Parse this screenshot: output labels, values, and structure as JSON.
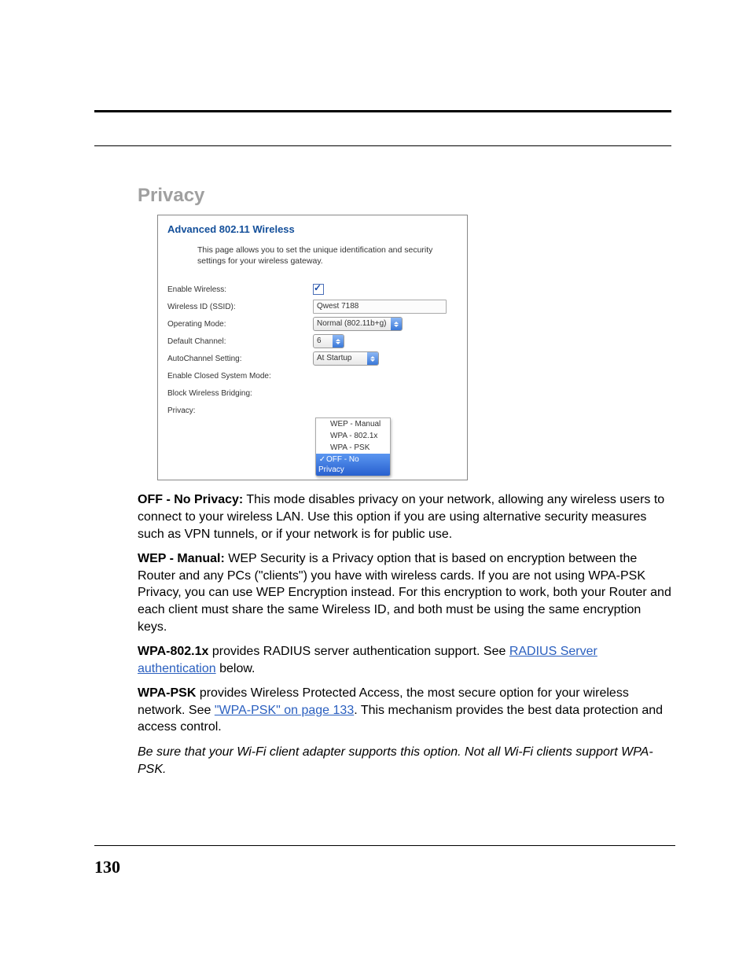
{
  "page_number": "130",
  "section_title": "Privacy",
  "screenshot": {
    "title": "Advanced 802.11 Wireless",
    "description": "This page allows you to set the unique identification and security settings for your wireless gateway.",
    "fields": {
      "enable_wireless": {
        "label": "Enable Wireless:",
        "checked": true
      },
      "ssid": {
        "label": "Wireless ID (SSID):",
        "value": "Qwest 7188"
      },
      "op_mode": {
        "label": "Operating Mode:",
        "value": "Normal (802.11b+g)"
      },
      "channel": {
        "label": "Default Channel:",
        "value": "6"
      },
      "autochannel": {
        "label": "AutoChannel Setting:",
        "value": "At Startup"
      },
      "closed_system": {
        "label": "Enable Closed System Mode:"
      },
      "block_bridging": {
        "label": "Block Wireless Bridging:"
      },
      "privacy": {
        "label": "Privacy:"
      }
    },
    "privacy_options": [
      "WEP - Manual",
      "WPA - 802.1x",
      "WPA - PSK",
      "OFF - No Privacy"
    ],
    "privacy_selected": "OFF - No Privacy"
  },
  "paragraphs": {
    "off": {
      "heading": "OFF - No Privacy:",
      "text": " This mode disables privacy on your network, allowing any wireless users to connect to your wireless LAN. Use this option if you are using alternative security measures such as VPN tunnels, or if your network is for public use."
    },
    "wep": {
      "heading": "WEP - Manual:",
      "text": " WEP Security is a Privacy option that is based on encryption between the Router and any PCs (\"clients\") you have with wireless cards. If you are not using WPA-PSK Privacy, you can use WEP Encryption instead. For this encryption to work, both your Router and each client must share the same Wireless ID, and both must be using the same encryption keys."
    },
    "wpa1x": {
      "heading": "WPA-802.1x",
      "pre": " provides RADIUS server authentication support. See ",
      "link": "RADIUS Server authentication",
      "post": " below."
    },
    "wpapsk": {
      "heading": "WPA-PSK",
      "pre": " provides Wireless Protected Access, the most secure option for your wireless network. See ",
      "link": "\"WPA-PSK\" on page 133",
      "post": ". This mechanism provides the best data protection and access control."
    },
    "note": "Be sure that your Wi-Fi client adapter supports this option. Not all Wi-Fi clients support WPA-PSK."
  }
}
